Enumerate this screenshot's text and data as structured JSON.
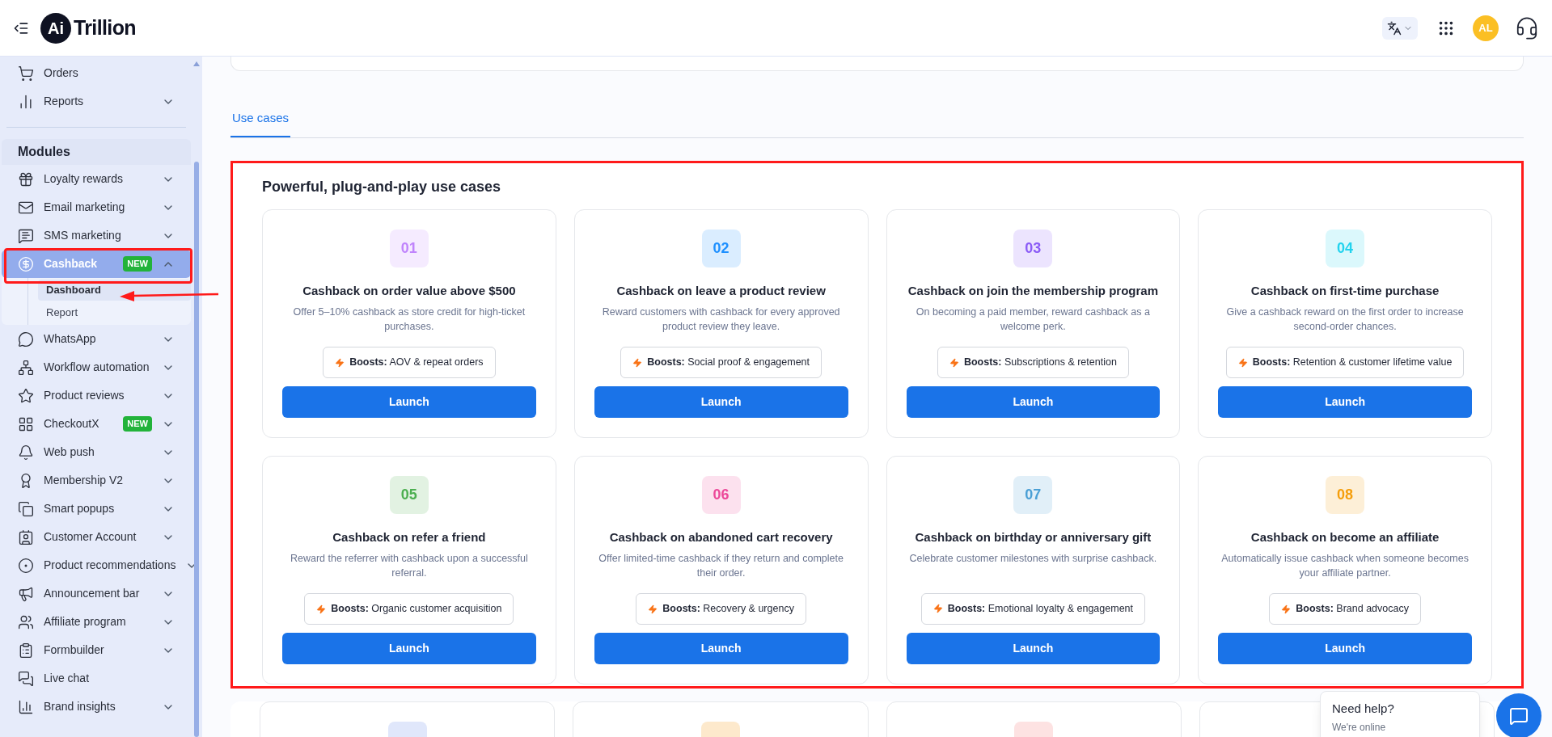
{
  "header": {
    "logo_mark": "Ai",
    "logo_text": "Trillion",
    "avatar": "AL"
  },
  "sidebar": {
    "top_items": [
      {
        "label": "Orders",
        "kind": "link"
      },
      {
        "label": "Reports",
        "kind": "group",
        "expanded": false
      }
    ],
    "modules_heading": "Modules",
    "modules": [
      {
        "label": "Loyalty rewards",
        "kind": "group",
        "expanded": false,
        "selected": false
      },
      {
        "label": "Email marketing",
        "kind": "group",
        "expanded": false,
        "selected": false
      },
      {
        "label": "SMS marketing",
        "kind": "group",
        "expanded": false,
        "selected": false
      },
      {
        "label": "Cashback",
        "badge": "NEW",
        "kind": "group",
        "expanded": true,
        "selected": true,
        "children": [
          {
            "label": "Dashboard",
            "selected": true
          },
          {
            "label": "Report",
            "selected": false
          }
        ]
      },
      {
        "label": "WhatsApp",
        "kind": "group",
        "expanded": false,
        "selected": false
      },
      {
        "label": "Workflow automation",
        "kind": "group",
        "expanded": false,
        "selected": false
      },
      {
        "label": "Product reviews",
        "kind": "group",
        "expanded": false,
        "selected": false
      },
      {
        "label": "CheckoutX",
        "badge": "NEW",
        "kind": "group",
        "expanded": false,
        "selected": false
      },
      {
        "label": "Web push",
        "kind": "group",
        "expanded": false,
        "selected": false
      },
      {
        "label": "Membership V2",
        "kind": "group",
        "expanded": false,
        "selected": false
      },
      {
        "label": "Smart popups",
        "kind": "group",
        "expanded": false,
        "selected": false
      },
      {
        "label": "Customer Account",
        "kind": "group",
        "expanded": false,
        "selected": false
      },
      {
        "label": "Product recommendations",
        "kind": "group",
        "expanded": false,
        "selected": false
      },
      {
        "label": "Announcement bar",
        "kind": "group",
        "expanded": false,
        "selected": false
      },
      {
        "label": "Affiliate program",
        "kind": "group",
        "expanded": false,
        "selected": false
      },
      {
        "label": "Formbuilder",
        "kind": "group",
        "expanded": false,
        "selected": false
      },
      {
        "label": "Live chat",
        "kind": "link",
        "selected": false
      },
      {
        "label": "Brand insights",
        "kind": "group",
        "expanded": false,
        "selected": false
      }
    ]
  },
  "tabs": [
    {
      "label": "Use cases",
      "selected": true
    }
  ],
  "panel": {
    "title": "Powerful, plug-and-play use cases",
    "cards": [
      {
        "number": "01",
        "color": "#c084fc",
        "title": "Cashback on order value above $500",
        "description": "Offer 5–10% cashback as store credit for high-ticket purchases.",
        "boosts_label": "Boosts:",
        "boosts": "AOV & repeat orders",
        "button": "Launch"
      },
      {
        "number": "02",
        "color": "#1e90ff",
        "title": "Cashback on leave a product review",
        "description": "Reward customers with cashback for every approved product review they leave.",
        "boosts_label": "Boosts:",
        "boosts": "Social proof & engagement",
        "button": "Launch"
      },
      {
        "number": "03",
        "color": "#8b5cf6",
        "title": "Cashback on join the membership program",
        "description": "On becoming a paid member, reward cashback as a welcome perk.",
        "boosts_label": "Boosts:",
        "boosts": "Subscriptions & retention",
        "button": "Launch"
      },
      {
        "number": "04",
        "color": "#22d3ee",
        "title": "Cashback on first-time purchase",
        "description": "Give a cashback reward on the first order to increase second-order chances.",
        "boosts_label": "Boosts:",
        "boosts": "Retention & customer lifetime value",
        "button": "Launch"
      },
      {
        "number": "05",
        "color": "#4caf50",
        "title": "Cashback on refer a friend",
        "description": "Reward the referrer with cashback upon a successful referral.",
        "boosts_label": "Boosts:",
        "boosts": "Organic customer acquisition",
        "button": "Launch"
      },
      {
        "number": "06",
        "color": "#ec4899",
        "title": "Cashback on abandoned cart recovery",
        "description": "Offer limited-time cashback if they return and complete their order.",
        "boosts_label": "Boosts:",
        "boosts": "Recovery & urgency",
        "button": "Launch"
      },
      {
        "number": "07",
        "color": "#4a9fd5",
        "title": "Cashback on birthday or anniversary gift",
        "description": "Celebrate customer milestones with surprise cashback.",
        "boosts_label": "Boosts:",
        "boosts": "Emotional loyalty & engagement",
        "button": "Launch"
      },
      {
        "number": "08",
        "color": "#f59e0b",
        "title": "Cashback on become an affiliate",
        "description": "Automatically issue cashback when someone becomes your affiliate partner.",
        "boosts_label": "Boosts:",
        "boosts": "Brand advocacy",
        "button": "Launch"
      }
    ]
  },
  "more_cards": [
    {
      "color": "#e0e7fb"
    },
    {
      "color": "#fde9cc"
    },
    {
      "color": "#fde2e2"
    }
  ],
  "help": {
    "title": "Need help?",
    "status": "We're online"
  }
}
